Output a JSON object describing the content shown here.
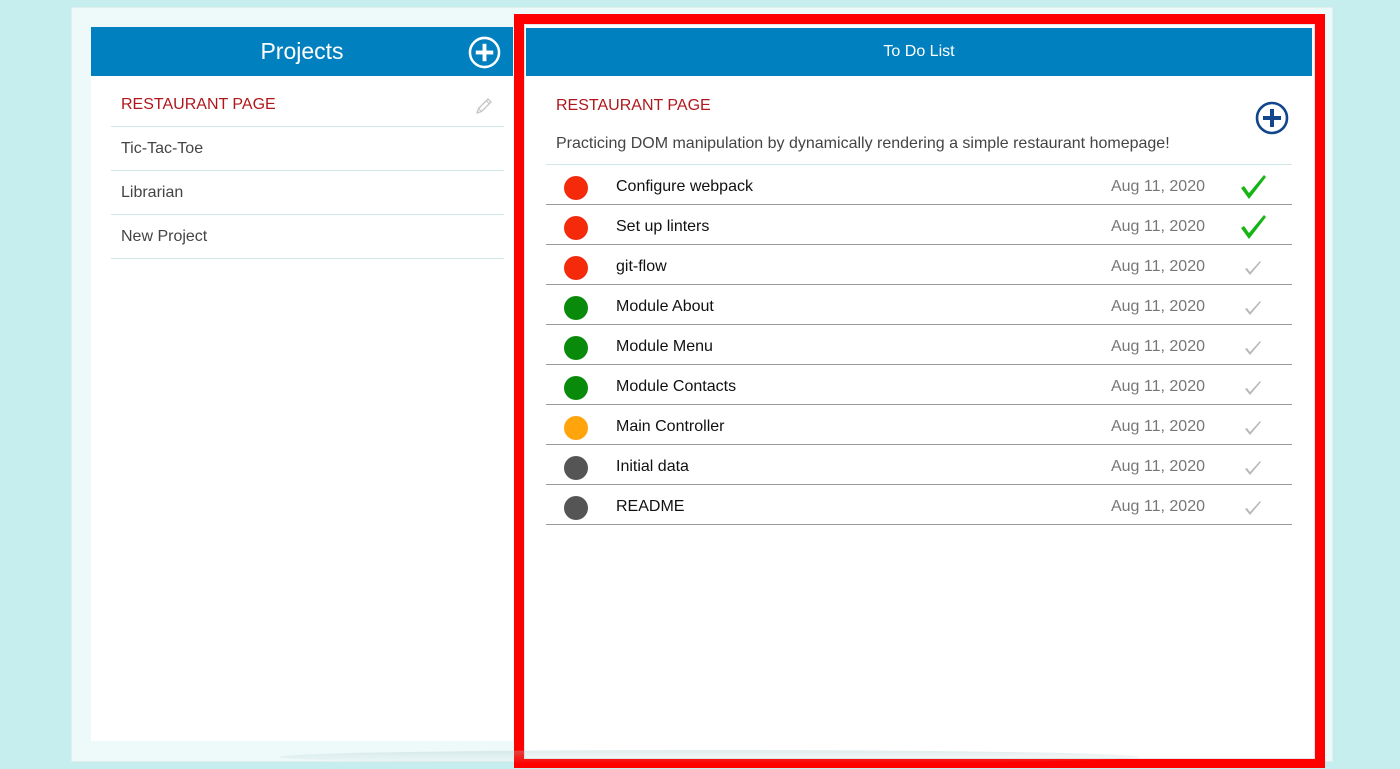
{
  "sidebar": {
    "title": "Projects",
    "projects": [
      {
        "label": "RESTAURANT PAGE",
        "active": true
      },
      {
        "label": "Tic-Tac-Toe",
        "active": false
      },
      {
        "label": "Librarian",
        "active": false
      },
      {
        "label": "New Project",
        "active": false
      }
    ]
  },
  "todo": {
    "header": "To Do List",
    "project_title": "RESTAURANT PAGE",
    "project_description": "Practicing DOM manipulation by dynamically rendering a simple restaurant homepage!",
    "items": [
      {
        "title": "Configure webpack",
        "date": "Aug 11, 2020",
        "priority_color": "#f52a0a",
        "done": true
      },
      {
        "title": "Set up linters",
        "date": "Aug 11, 2020",
        "priority_color": "#f52a0a",
        "done": true
      },
      {
        "title": "git-flow",
        "date": "Aug 11, 2020",
        "priority_color": "#f52a0a",
        "done": false
      },
      {
        "title": "Module About",
        "date": "Aug 11, 2020",
        "priority_color": "#0a8a0a",
        "done": false
      },
      {
        "title": "Module Menu",
        "date": "Aug 11, 2020",
        "priority_color": "#0a8a0a",
        "done": false
      },
      {
        "title": "Module Contacts",
        "date": "Aug 11, 2020",
        "priority_color": "#0a8a0a",
        "done": false
      },
      {
        "title": "Main Controller",
        "date": "Aug 11, 2020",
        "priority_color": "#ffa40a",
        "done": false
      },
      {
        "title": "Initial data",
        "date": "Aug 11, 2020",
        "priority_color": "#555555",
        "done": false
      },
      {
        "title": "README",
        "date": "Aug 11, 2020",
        "priority_color": "#555555",
        "done": false
      }
    ]
  },
  "colors": {
    "header_blue": "#0180c0",
    "active_red": "#b0171c",
    "check_done": "#16b516",
    "check_pending": "#b8b8b8",
    "highlight_outline": "#ff0000"
  },
  "icons": {
    "sidebar_add": "plus-circle-icon",
    "edit": "pencil-icon",
    "todo_add": "plus-circle-icon",
    "check": "check-icon"
  }
}
